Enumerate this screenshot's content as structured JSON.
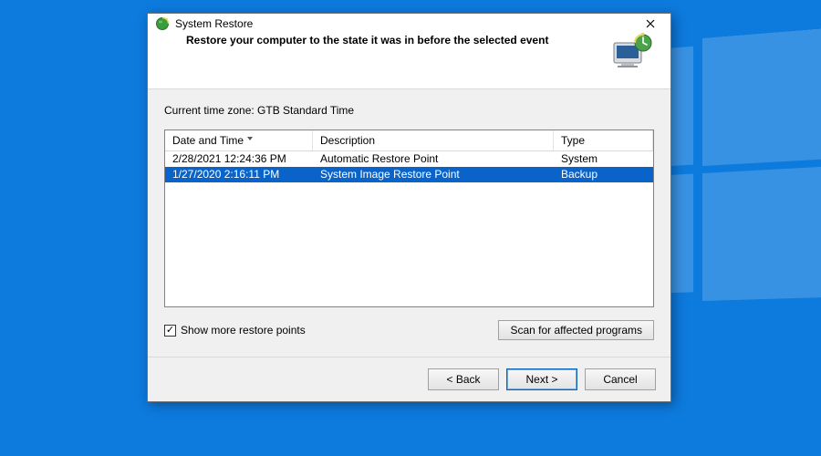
{
  "window": {
    "title": "System Restore"
  },
  "header": {
    "heading": "Restore your computer to the state it was in before the selected event"
  },
  "time_zone": {
    "label_prefix": "Current time zone: ",
    "zone": "GTB Standard Time"
  },
  "columns": {
    "date": "Date and Time",
    "desc": "Description",
    "type": "Type"
  },
  "restore_points": [
    {
      "date": "2/28/2021 12:24:36 PM",
      "desc": "Automatic Restore Point",
      "type": "System",
      "selected": false
    },
    {
      "date": "1/27/2020 2:16:11 PM",
      "desc": "System Image Restore Point",
      "type": "Backup",
      "selected": true
    }
  ],
  "below": {
    "show_more": {
      "checked": true,
      "label": "Show more restore points"
    },
    "scan_label": "Scan for affected programs"
  },
  "buttons": {
    "back": "< Back",
    "next": "Next >",
    "cancel": "Cancel"
  },
  "icons": {
    "titlebar": "restore-globe-icon",
    "close": "close-icon",
    "header_art": "system-restore-art-icon",
    "checkmark": "✓"
  }
}
